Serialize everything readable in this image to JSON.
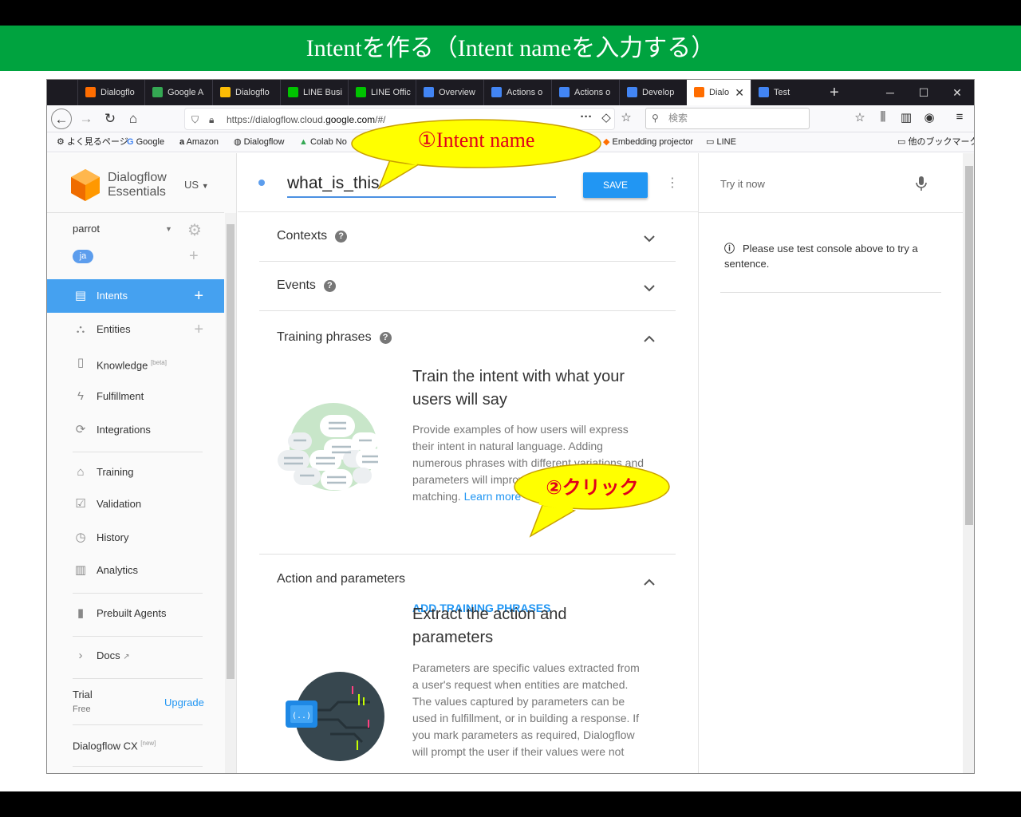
{
  "banner": {
    "title": "Intentを作る（Intent nameを入力する）"
  },
  "browser": {
    "tabs": [
      {
        "label": "Dialogflo",
        "color": "#ff6d00"
      },
      {
        "label": "Google A",
        "color": "#34a853"
      },
      {
        "label": "Dialogflo",
        "color": "#fbbc05"
      },
      {
        "label": "LINE Busi",
        "color": "#00c300"
      },
      {
        "label": "LINE Offic",
        "color": "#00c300"
      },
      {
        "label": "Overview",
        "color": "#4285f4"
      },
      {
        "label": "Actions o",
        "color": "#4285f4"
      },
      {
        "label": "Actions o",
        "color": "#4285f4"
      },
      {
        "label": "Develop",
        "color": "#4285f4"
      },
      {
        "label": "Dialo",
        "color": "#ff6d00"
      },
      {
        "label": "Test",
        "color": "#4285f4"
      }
    ],
    "new_tab": "+",
    "window": {
      "minimize": "─",
      "maximize": "☐",
      "close": "✕"
    },
    "url_prefix": "https://dialogflow.cloud.",
    "url_domain": "google.com",
    "url_suffix": "/#/",
    "search_placeholder": "検索",
    "bookmarks": [
      "よく見るページ",
      "Google",
      "Amazon",
      "Dialogflow",
      "Colab No",
      "Embedding projector",
      "LINE",
      "他のブックマーク"
    ]
  },
  "sidebar": {
    "logo_line1": "Dialogflow",
    "logo_line2": "Essentials",
    "region": "US",
    "agent": "parrot",
    "language": "ja",
    "items": [
      {
        "label": "Intents",
        "icon": "chat-icon"
      },
      {
        "label": "Entities",
        "icon": "hierarchy-icon"
      },
      {
        "label": "Knowledge",
        "tag": "[beta]",
        "icon": "book-icon"
      },
      {
        "label": "Fulfillment",
        "icon": "bolt-icon"
      },
      {
        "label": "Integrations",
        "icon": "sync-icon"
      },
      {
        "label": "Training",
        "icon": "graduation-icon"
      },
      {
        "label": "Validation",
        "icon": "check-box-icon"
      },
      {
        "label": "History",
        "icon": "clock-icon"
      },
      {
        "label": "Analytics",
        "icon": "chart-icon"
      },
      {
        "label": "Prebuilt Agents",
        "icon": "bookmark-icon"
      },
      {
        "label": "Docs",
        "icon": "chevron-right-icon"
      }
    ],
    "trial": "Trial",
    "trial_sub": "Free",
    "upgrade": "Upgrade",
    "cx": "Dialogflow CX",
    "cx_tag": "[new]"
  },
  "main": {
    "intent_name": "what_is_this",
    "save": "SAVE",
    "sections": {
      "contexts": "Contexts",
      "events": "Events",
      "training": "Training phrases",
      "action": "Action and parameters"
    },
    "training_heading": "Train the intent with what your users will say",
    "training_desc": "Provide examples of how users will express their intent in natural language. Adding numerous phrases with different variations and parameters will improve the accuracy of intent matching.",
    "learn_more": "Learn more",
    "add_training": "ADD TRAINING PHRASES",
    "action_heading": "Extract the action and parameters",
    "action_desc": "Parameters are specific values extracted from a user's request when entities are matched. The values captured by parameters can be used in fulfillment, or in building a response. If you mark parameters as required, Dialogflow will prompt the user if their values were not"
  },
  "right": {
    "try_it": "Try it now",
    "message": "Please use test console above to try a sentence."
  },
  "callouts": {
    "first": "①Intent name",
    "second": "②クリック"
  },
  "colors": {
    "accent": "#2196f3",
    "banner": "#00a33f",
    "callout_fill": "#ffff00"
  }
}
